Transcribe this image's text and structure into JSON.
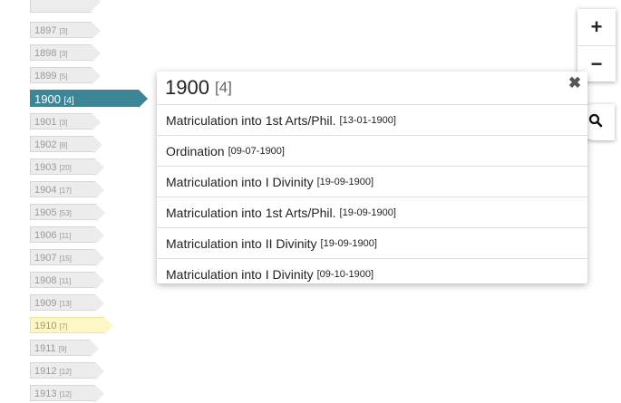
{
  "years": [
    {
      "year": "",
      "count": ""
    },
    {
      "year": "1897",
      "count": "[3]"
    },
    {
      "year": "1898",
      "count": "[3]"
    },
    {
      "year": "1899",
      "count": "[5]"
    },
    {
      "year": "1900",
      "count": "[4]"
    },
    {
      "year": "1901",
      "count": "[3]"
    },
    {
      "year": "1902",
      "count": "[8]"
    },
    {
      "year": "1903",
      "count": "[20]"
    },
    {
      "year": "1904",
      "count": "[17]"
    },
    {
      "year": "1905",
      "count": "[53]"
    },
    {
      "year": "1906",
      "count": "[11]"
    },
    {
      "year": "1907",
      "count": "[15]"
    },
    {
      "year": "1908",
      "count": "[11]"
    },
    {
      "year": "1909",
      "count": "[13]"
    },
    {
      "year": "1910",
      "count": "[7]"
    },
    {
      "year": "1911",
      "count": "[9]"
    },
    {
      "year": "1912",
      "count": "[12]"
    },
    {
      "year": "1913",
      "count": "[12]"
    }
  ],
  "controls": {
    "zoom_in": "+",
    "zoom_out": "−"
  },
  "popup": {
    "year": "1900",
    "count": "[4]",
    "close": "✖",
    "events": [
      {
        "title": "Matriculation into 1st Arts/Phil.",
        "date": "[13-01-1900]"
      },
      {
        "title": "Ordination",
        "date": "[09-07-1900]"
      },
      {
        "title": "Matriculation into I Divinity",
        "date": "[19-09-1900]"
      },
      {
        "title": "Matriculation into 1st Arts/Phil.",
        "date": "[19-09-1900]"
      },
      {
        "title": "Matriculation into II Divinity",
        "date": "[19-09-1900]"
      },
      {
        "title": "Matriculation into I Divinity",
        "date": "[09-10-1900]"
      }
    ]
  },
  "colors": {
    "active_tag": "#3d8698",
    "highlight_tag": "#fdf6c6",
    "tag": "#ececec"
  }
}
